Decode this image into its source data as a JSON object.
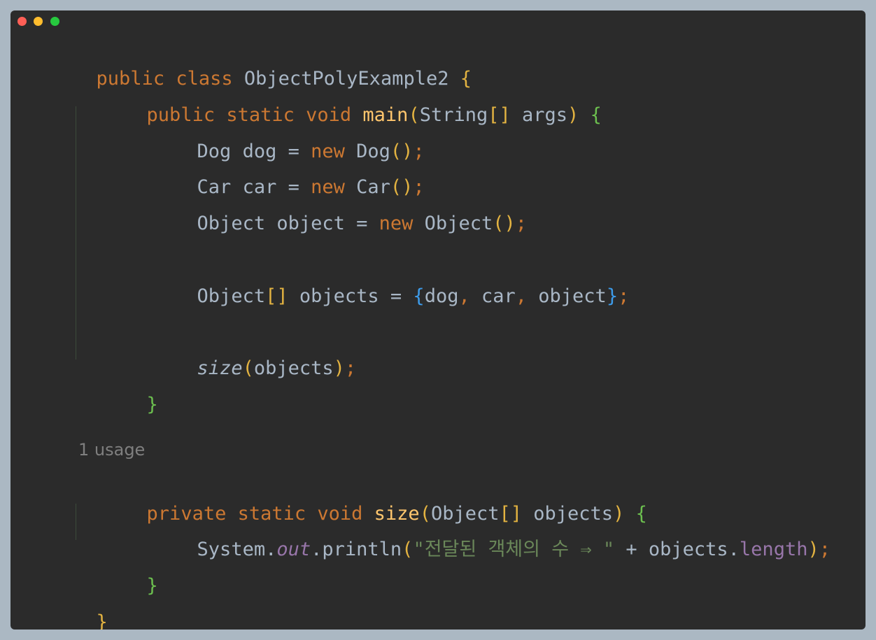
{
  "window": {
    "buttons": [
      "close",
      "minimize",
      "maximize"
    ]
  },
  "code": {
    "l1": {
      "a": "public class ",
      "b": "ObjectPolyExample2 ",
      "c": "{"
    },
    "l2": {
      "a": "public static void ",
      "b": "main",
      "c": "(",
      "d": "String",
      "e": "[]",
      "f": " args",
      "g": ")",
      "h": " {"
    },
    "l3": {
      "a": "Dog dog = ",
      "b": "new ",
      "c": "Dog",
      "d": "()",
      "e": ";"
    },
    "l4": {
      "a": "Car car = ",
      "b": "new ",
      "c": "Car",
      "d": "()",
      "e": ";"
    },
    "l5": {
      "a": "Object object = ",
      "b": "new ",
      "c": "Object",
      "d": "()",
      "e": ";"
    },
    "l6": {
      "a": "Object",
      "b": "[]",
      "c": " objects = ",
      "d": "{",
      "e": "dog",
      "f": ", ",
      "g": "car",
      "h": ", ",
      "i": "object",
      "j": "}",
      "k": ";"
    },
    "l7": {
      "a": "size",
      "b": "(",
      "c": "objects",
      "d": ")",
      "e": ";"
    },
    "l8": {
      "a": "}"
    },
    "usage": "1 usage",
    "l9": {
      "a": "private static void ",
      "b": "size",
      "c": "(",
      "d": "Object",
      "e": "[]",
      "f": " objects",
      "g": ")",
      "h": " {"
    },
    "l10": {
      "a": "System.",
      "b": "out",
      "c": ".println",
      "d": "(",
      "e": "\"전달된 객체의 수 ⇒ \"",
      "f": " + objects.",
      "g": "length",
      "h": ")",
      "i": ";"
    },
    "l11": {
      "a": "}"
    },
    "l12": {
      "a": "}"
    }
  }
}
